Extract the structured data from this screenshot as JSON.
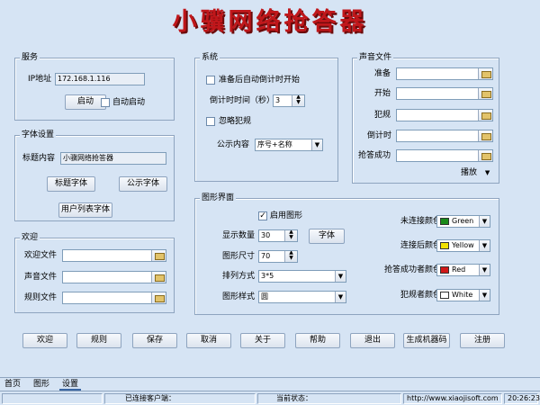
{
  "app_title": "小骥网络抢答器",
  "service": {
    "legend": "服务",
    "ip_label": "IP地址",
    "ip_value": "172.168.1.116",
    "start_button": "启动",
    "autostart_label": "自动启动"
  },
  "font_settings": {
    "legend": "字体设置",
    "title_content_label": "标题内容",
    "title_content_value": "小骥网络抢答器",
    "title_font_button": "标题字体",
    "notice_font_button": "公示字体",
    "userlist_font_button": "用户列表字体"
  },
  "welcome": {
    "legend": "欢迎",
    "welcome_file_label": "欢迎文件",
    "sound_file_label": "声音文件",
    "rules_file_label": "规则文件"
  },
  "system": {
    "legend": "系统",
    "auto_countdown_label": "准备后自动倒计时开始",
    "countdown_label": "倒计时时间（秒）",
    "countdown_value": "3",
    "ignore_foul_label": "忽略犯规",
    "notice_content_label": "公示内容",
    "notice_content_value": "序号+名称"
  },
  "sound_files": {
    "legend": "声音文件",
    "ready_label": "准备",
    "start_label": "开始",
    "foul_label": "犯规",
    "countdown_label": "倒计时",
    "success_label": "抢答成功",
    "play_label": "播放"
  },
  "graphics": {
    "legend": "图形界面",
    "enable_label": "启用图形",
    "display_count_label": "显示数量",
    "display_count_value": "30",
    "font_button": "字体",
    "size_label": "图形尺寸",
    "size_value": "70",
    "layout_label": "排列方式",
    "layout_value": "3*5",
    "style_label": "图形样式",
    "style_value": "圆",
    "colors": [
      {
        "label": "未连接颜色",
        "name": "Green",
        "hex": "#1a8a1a"
      },
      {
        "label": "连接后颜色",
        "name": "Yellow",
        "hex": "#f2e200"
      },
      {
        "label": "抢答成功者颜色",
        "name": "Red",
        "hex": "#d01818"
      },
      {
        "label": "犯规者颜色",
        "name": "White",
        "hex": "#ffffff"
      }
    ]
  },
  "bottom_buttons": [
    "欢迎",
    "规则",
    "保存",
    "取消",
    "关于",
    "帮助",
    "退出",
    "生成机器码",
    "注册"
  ],
  "tabs": [
    "首页",
    "图形",
    "设置"
  ],
  "status_bar": {
    "connected_label": "已连接客户端：",
    "current_status_label": "当前状态：",
    "url": "http://www.xiaojisoft.com",
    "time": "20:26:23"
  }
}
